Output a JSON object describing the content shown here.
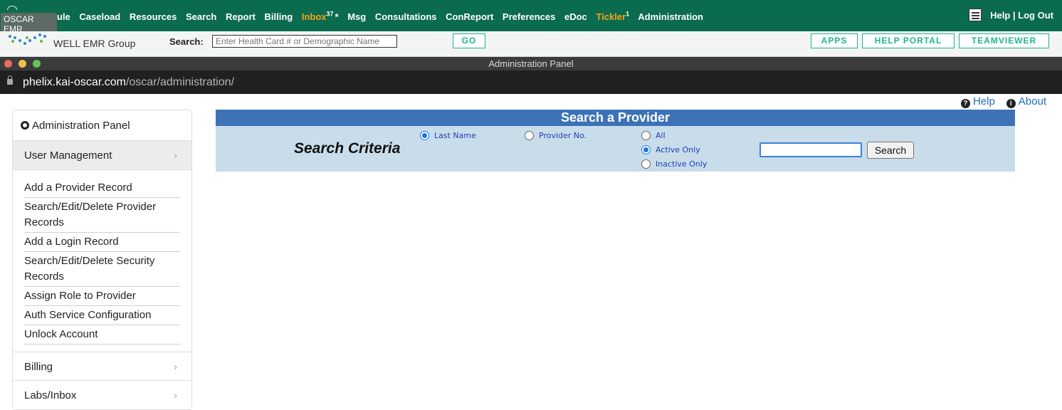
{
  "brand": {
    "badge": "OSCAR EMR"
  },
  "nav": {
    "items": [
      {
        "label": "ule",
        "color": "white"
      },
      {
        "label": "Caseload",
        "color": "white"
      },
      {
        "label": "Resources",
        "color": "white"
      },
      {
        "label": "Search",
        "color": "white"
      },
      {
        "label": "Report",
        "color": "white"
      },
      {
        "label": "Billing",
        "color": "white"
      }
    ],
    "inbox": {
      "label": "Inbox",
      "count": "37",
      "star": "*"
    },
    "items2": [
      {
        "label": "Msg"
      },
      {
        "label": "Consultations"
      },
      {
        "label": "ConReport"
      },
      {
        "label": "Preferences"
      },
      {
        "label": "eDoc"
      }
    ],
    "tickler": {
      "label": "Tickler",
      "count": "1"
    },
    "admin": "Administration",
    "right": "Help | Log Out"
  },
  "searchbar": {
    "logo_text": "WELL EMR Group",
    "label": "Search:",
    "placeholder": "Enter Health Card # or Demographic Name",
    "go": "GO",
    "apps": "APPS",
    "help_portal": "HELP PORTAL",
    "teamviewer": "TEAMVIEWER"
  },
  "window": {
    "title": "Administration Panel",
    "url_host": "phelix.kai-oscar.com",
    "url_path": "/oscar/administration/"
  },
  "links": {
    "help": "Help",
    "about": "About"
  },
  "sidebar": {
    "title": "Administration Panel",
    "section": "User Management",
    "items": [
      "Add a Provider Record",
      "Search/Edit/Delete Provider Records",
      "Add a Login Record",
      "Search/Edit/Delete Security Records",
      "Assign Role to Provider",
      "Auth Service Configuration",
      "Unlock Account"
    ],
    "sections_after": [
      "Billing",
      "Labs/Inbox"
    ]
  },
  "panel": {
    "title": "Search a Provider",
    "criteria": "Search Criteria",
    "radios_field": [
      {
        "label": "Last Name",
        "checked": true
      },
      {
        "label": "Provider No.",
        "checked": false
      }
    ],
    "radios_status": [
      {
        "label": "All",
        "checked": false
      },
      {
        "label": "Active Only",
        "checked": true
      },
      {
        "label": "Inactive Only",
        "checked": false
      }
    ],
    "input_value": "",
    "button": "Search"
  },
  "colors": {
    "nav_bg": "#0b6b4e",
    "accent_orange": "#f7a21b",
    "panel_header": "#3d72b6",
    "panel_bg": "#c8dcea",
    "teal": "#21b58e"
  }
}
